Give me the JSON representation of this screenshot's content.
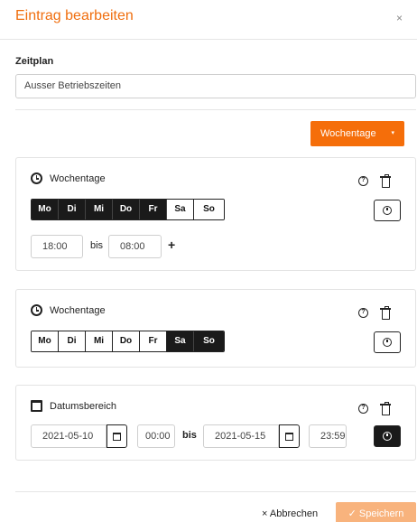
{
  "modal": {
    "title": "Eintrag bearbeiten",
    "close": "×"
  },
  "schedule": {
    "label": "Zeitplan",
    "value": "Ausser Betriebszeiten"
  },
  "type_dropdown": {
    "label": "Wochentage",
    "caret": "▾"
  },
  "cards": [
    {
      "title": "Wochentage",
      "days": [
        {
          "label": "Mo",
          "selected": true
        },
        {
          "label": "Di",
          "selected": true
        },
        {
          "label": "Mi",
          "selected": true
        },
        {
          "label": "Do",
          "selected": true
        },
        {
          "label": "Fr",
          "selected": true
        },
        {
          "label": "Sa",
          "selected": false
        },
        {
          "label": "So",
          "selected": false
        }
      ],
      "from": "18:00",
      "bis": "bis",
      "to": "08:00",
      "add": "+"
    },
    {
      "title": "Wochentage",
      "days": [
        {
          "label": "Mo",
          "selected": false
        },
        {
          "label": "Di",
          "selected": false
        },
        {
          "label": "Mi",
          "selected": false
        },
        {
          "label": "Do",
          "selected": false
        },
        {
          "label": "Fr",
          "selected": false
        },
        {
          "label": "Sa",
          "selected": true
        },
        {
          "label": "So",
          "selected": true
        }
      ]
    },
    {
      "title": "Datumsbereich",
      "start_date": "2021-05-10",
      "start_time": "00:00",
      "bis": "bis",
      "end_date": "2021-05-15",
      "end_time": "23:59"
    }
  ],
  "footer": {
    "cancel": "× Abbrechen",
    "save": "✓ Speichern"
  },
  "colors": {
    "accent": "#f56e0a",
    "save_disabled": "#f8b37d",
    "dark": "#1a1a1a"
  }
}
